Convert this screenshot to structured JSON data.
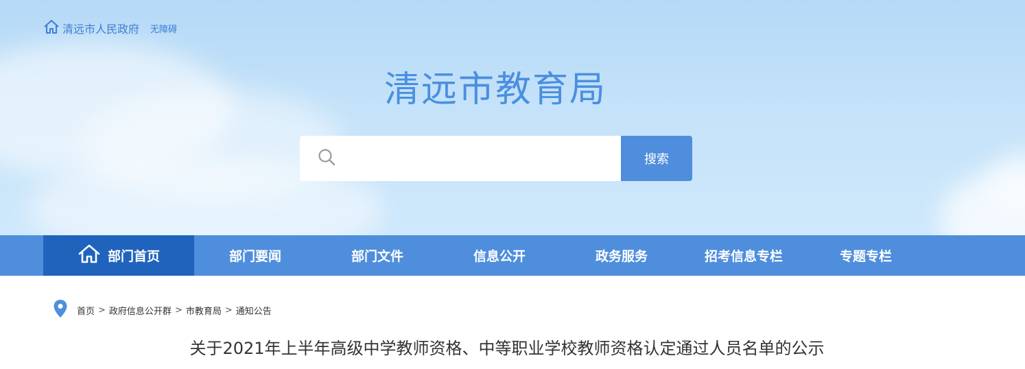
{
  "top_bar": {
    "gov_link": "清远市人民政府",
    "accessibility": "无障碍"
  },
  "site": {
    "title": "清远市教育局"
  },
  "search": {
    "placeholder": "",
    "button_label": "搜索"
  },
  "nav": {
    "items": [
      {
        "label": "部门首页",
        "active": true
      },
      {
        "label": "部门要闻"
      },
      {
        "label": "部门文件"
      },
      {
        "label": "信息公开"
      },
      {
        "label": "政务服务"
      },
      {
        "label": "招考信息专栏"
      },
      {
        "label": "专题专栏"
      }
    ]
  },
  "breadcrumb": {
    "items": [
      "首页",
      "政府信息公开群",
      "市教育局",
      "通知公告"
    ],
    "separator": ">"
  },
  "article": {
    "title": "关于2021年上半年高级中学教师资格、中等职业学校教师资格认定通过人员名单的公示"
  },
  "colors": {
    "accent": "#4f8edc",
    "nav_active": "#1f63bd",
    "title_blue": "#4a8fe0",
    "sky": "#c4e2f9"
  }
}
